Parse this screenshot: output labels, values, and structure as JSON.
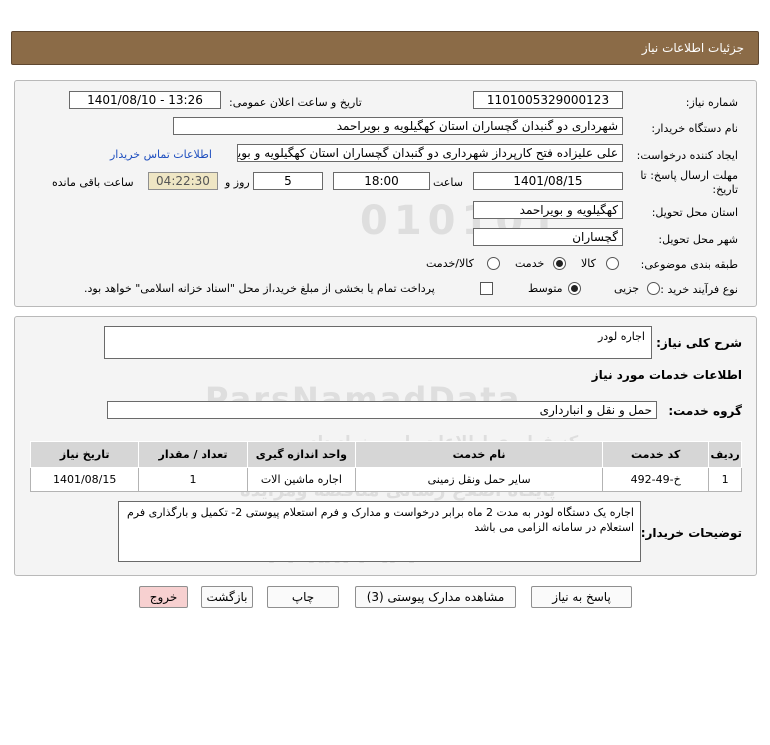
{
  "header": {
    "title": "جزئیات اطلاعات نیاز"
  },
  "fields": {
    "need_number_label": "شماره نیاز:",
    "need_number": "1101005329000123",
    "announce_label": "تاریخ و ساعت اعلان عمومی:",
    "announce_value": "1401/08/10 - 13:26",
    "buyer_label": "نام دستگاه خریدار:",
    "buyer_value": "شهرداری دو گنبدان گچساران استان کهگیلویه و بویراحمد",
    "creator_label": "ایجاد کننده درخواست:",
    "creator_value": "علی علیزاده فتح کارپرداز شهرداری دو گنبدان گچساران استان کهگیلویه و بویراحمد",
    "contact_link": "اطلاعات تماس خریدار",
    "deadline_label_1": "مهلت ارسال پاسخ: تا",
    "deadline_label_2": "تاریخ:",
    "deadline_date": "1401/08/15",
    "time_label": "ساعت",
    "deadline_time": "18:00",
    "days_value": "5",
    "days_label": "روز و",
    "remaining_time": "04:22:30",
    "remaining_label": "ساعت باقی مانده",
    "province_label": "استان محل تحویل:",
    "province_value": "کهگیلویه و بویراحمد",
    "city_label": "شهر محل تحویل:",
    "city_value": "گچساران",
    "category_label": "طبقه بندی موضوعی:",
    "category_options": [
      "کالا",
      "خدمت",
      "کالا/خدمت"
    ],
    "category_selected": "خدمت",
    "purchase_label": "نوع فرآیند خرید :",
    "purchase_options": [
      "جزیی",
      "متوسط"
    ],
    "purchase_selected": "متوسط",
    "payment_note": "پرداخت تمام یا بخشی از مبلغ خرید،از محل \"اسناد خزانه اسلامی\" خواهد بود."
  },
  "summary": {
    "label": "شرح کلی نیاز:",
    "value": "اجاره لودر"
  },
  "services": {
    "section_title": "اطلاعات خدمات مورد نیاز",
    "group_label": "گروه خدمت:",
    "group_value": "حمل و نقل و انبارداری",
    "table": {
      "headers": [
        "ردیف",
        "کد خدمت",
        "نام خدمت",
        "واحد اندازه گیری",
        "تعداد / مقدار",
        "تاریخ نیاز"
      ],
      "rows": [
        [
          "1",
          "خ-49-492",
          "سایر حمل ونقل زمینی",
          "اجاره ماشین الات",
          "1",
          "1401/08/15"
        ]
      ]
    }
  },
  "buyer_notes": {
    "label": "توضیحات خریدار:",
    "value": "اجاره  یک دستگاه لودر به مدت 2 ماه  برابر درخواست و مدارک  و فرم استعلام پیوستی  2- تکمیل و بارگذاری فرم استعلام  در سامانه الزامی می باشد"
  },
  "buttons": {
    "reply": "پاسخ به نیاز",
    "attachments": "مشاهده مدارک پیوستی (3)",
    "print": "چاپ",
    "back": "بازگشت",
    "exit": "خروج"
  },
  "watermark": {
    "line1": "ParsNamadData",
    "line2": "مرکز فراوری اطلاعات پارس نماد داده",
    "line3": "پایگاه اصلاع رسانی مناقصه ومزایده",
    "line4": "۰۲۱-۸۸۳۴۹۶۷۰"
  },
  "colors": {
    "header_bg": "#8b6b47",
    "link": "#1f4fbf",
    "exit_button": "#f7d0d0",
    "remaining_bg": "#efe6c4"
  }
}
